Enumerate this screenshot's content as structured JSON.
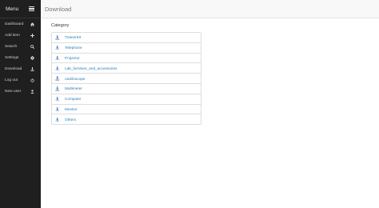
{
  "sidebar": {
    "title": "Menu",
    "menu_icon": "hamburger-icon",
    "items": [
      {
        "label": "Dashboard",
        "icon": "home-icon"
      },
      {
        "label": "Add item",
        "icon": "plus-icon"
      },
      {
        "label": "Search",
        "icon": "search-icon"
      },
      {
        "label": "Settings",
        "icon": "gear-icon"
      },
      {
        "label": "Download",
        "icon": "download-icon"
      },
      {
        "label": "Log out",
        "icon": "power-icon"
      },
      {
        "label": "New user",
        "icon": "user-icon"
      }
    ]
  },
  "header": {
    "title": "Download"
  },
  "main": {
    "heading": "Category",
    "items": [
      {
        "label": "TrainerKit",
        "icon": "download-icon"
      },
      {
        "label": "Telephone",
        "icon": "download-icon"
      },
      {
        "label": "Projector",
        "icon": "download-icon"
      },
      {
        "label": "Lab_furniture_and_accessories",
        "icon": "download-icon"
      },
      {
        "label": "oscilloscope",
        "icon": "download-icon"
      },
      {
        "label": "Multimeter",
        "icon": "download-icon"
      },
      {
        "label": "Computer",
        "icon": "download-icon"
      },
      {
        "label": "Monitor",
        "icon": "download-icon"
      },
      {
        "label": "Others",
        "icon": "download-icon"
      }
    ]
  },
  "colors": {
    "sidebar_bg": "#1f1f1f",
    "link": "#2a7ab5",
    "icon_blue": "#3b7bbf"
  }
}
